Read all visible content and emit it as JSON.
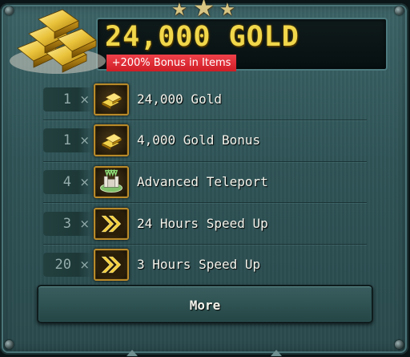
{
  "header": {
    "title": "24,000 GOLD",
    "bonus_badge": "+200% Bonus in Items"
  },
  "items": [
    {
      "quantity": "1",
      "multiplier": "×",
      "label": "24,000 Gold",
      "icon": "gold-bars-icon"
    },
    {
      "quantity": "1",
      "multiplier": "×",
      "label": "4,000 Gold Bonus",
      "icon": "gold-bars-icon"
    },
    {
      "quantity": "4",
      "multiplier": "×",
      "label": "Advanced Teleport",
      "icon": "teleport-castle-icon"
    },
    {
      "quantity": "3",
      "multiplier": "×",
      "label": "24 Hours Speed Up",
      "icon": "speed-up-arrows-icon"
    },
    {
      "quantity": "20",
      "multiplier": "×",
      "label": "3 Hours Speed Up",
      "icon": "speed-up-arrows-icon"
    }
  ],
  "more_button": {
    "label": "More"
  },
  "colors": {
    "panel": "#2f5457",
    "gold_text": "#f1d74a",
    "badge_red": "#e02a33",
    "icon_border": "#b98a2a"
  }
}
